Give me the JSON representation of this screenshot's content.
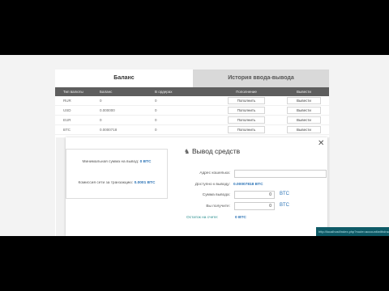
{
  "tabs": [
    {
      "label": "Баланс"
    },
    {
      "label": "История ввода-вывода"
    }
  ],
  "table": {
    "headers": [
      "Тип валюты",
      "Баланс",
      "В ордерах",
      "Пополнение",
      "Вывести"
    ],
    "rows": [
      {
        "currency": "RUR",
        "balance": "0",
        "orders": "0",
        "deposit": "Пополнить",
        "withdraw": "Вывести"
      },
      {
        "currency": "USD",
        "balance": "0.000000",
        "orders": "0",
        "deposit": "Пополнить",
        "withdraw": "Вывести"
      },
      {
        "currency": "EUR",
        "balance": "0",
        "orders": "0",
        "deposit": "Пополнить",
        "withdraw": "Вывести"
      },
      {
        "currency": "BTC",
        "balance": "0.0000718",
        "orders": "0",
        "deposit": "Пополнить",
        "withdraw": "Вывести"
      }
    ]
  },
  "modal": {
    "title": "Вывод средств",
    "info_min_label": "Минимальная сумма на вывод:",
    "info_min_value": "0 BTC",
    "info_fee_label": "Комиссия сети за транзакцию:",
    "info_fee_value": "0.0001 BTC",
    "address_label": "Адрес кошелька:",
    "address_value": "",
    "available_label": "Доступно к выводу:",
    "available_value": "0.00007818 BTC",
    "amount_label": "Сумма вывода:",
    "amount_value": "0",
    "amount_unit": "BTC",
    "receive_label": "Вы получите:",
    "receive_value": "0",
    "receive_unit": "BTC",
    "balance_label": "Остаток на счете:",
    "balance_value": "0 BTC"
  },
  "toast": {
    "text": "http://localhost/index.php?route=account/withdraw"
  },
  "colors": {
    "accent": "#2a72b5",
    "header": "#5e5e5e",
    "tab_inactive": "#d9d9d9"
  }
}
